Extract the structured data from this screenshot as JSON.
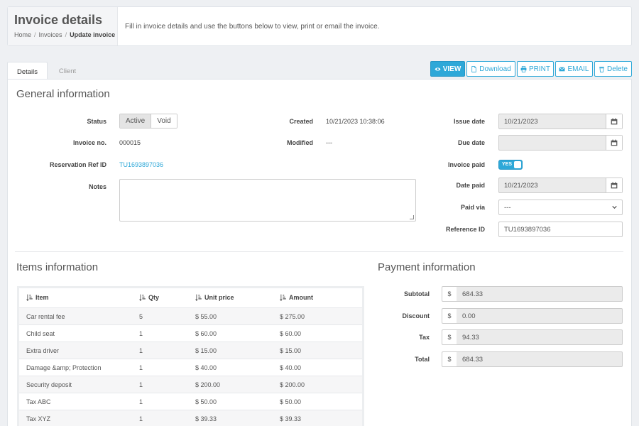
{
  "header": {
    "title": "Invoice details",
    "breadcrumb": [
      "Home",
      "Invoices",
      "Update invoice"
    ],
    "description": "Fill in invoice details and use the buttons below to view, print or email the invoice."
  },
  "tabs": {
    "details": "Details",
    "client": "Client"
  },
  "toolbar": {
    "view": "VIEW",
    "download": "Download",
    "print": "PRINT",
    "email": "EMAIL",
    "delete": "Delete"
  },
  "general": {
    "title": "General information",
    "status_label": "Status",
    "status_active": "Active",
    "status_void": "Void",
    "invoice_no_label": "Invoice no.",
    "invoice_no": "000015",
    "reservation_label": "Reservation Ref ID",
    "reservation_id": "TU1693897036",
    "notes_label": "Notes",
    "notes_value": "",
    "created_label": "Created",
    "created": "10/21/2023 10:38:06",
    "modified_label": "Modified",
    "modified": "---",
    "issue_date_label": "Issue date",
    "issue_date": "10/21/2023",
    "due_date_label": "Due date",
    "due_date": "",
    "invoice_paid_label": "Invoice paid",
    "invoice_paid": "YES",
    "date_paid_label": "Date paid",
    "date_paid": "10/21/2023",
    "paid_via_label": "Paid via",
    "paid_via": "---",
    "reference_label": "Reference ID",
    "reference_id": "TU1693897036"
  },
  "items": {
    "title": "Items information",
    "headers": {
      "item": "Item",
      "qty": "Qty",
      "unit_price": "Unit price",
      "amount": "Amount"
    },
    "rows": [
      {
        "item": "Car rental fee",
        "qty": "5",
        "unit_price": "$ 55.00",
        "amount": "$ 275.00"
      },
      {
        "item": "Child seat",
        "qty": "1",
        "unit_price": "$ 60.00",
        "amount": "$ 60.00"
      },
      {
        "item": "Extra driver",
        "qty": "1",
        "unit_price": "$ 15.00",
        "amount": "$ 15.00"
      },
      {
        "item": "Damage &amp; Protection",
        "qty": "1",
        "unit_price": "$ 40.00",
        "amount": "$ 40.00"
      },
      {
        "item": "Security deposit",
        "qty": "1",
        "unit_price": "$ 200.00",
        "amount": "$ 200.00"
      },
      {
        "item": "Tax ABC",
        "qty": "1",
        "unit_price": "$ 50.00",
        "amount": "$ 50.00"
      },
      {
        "item": "Tax XYZ",
        "qty": "1",
        "unit_price": "$ 39.33",
        "amount": "$ 39.33"
      }
    ]
  },
  "payment": {
    "title": "Payment information",
    "currency": "$",
    "subtotal_label": "Subtotal",
    "subtotal": "684.33",
    "discount_label": "Discount",
    "discount": "0.00",
    "tax_label": "Tax",
    "tax": "94.33",
    "total_label": "Total",
    "total": "684.33"
  },
  "colors": {
    "accent": "#2ea8d8",
    "page_bg": "#eef0f3"
  }
}
